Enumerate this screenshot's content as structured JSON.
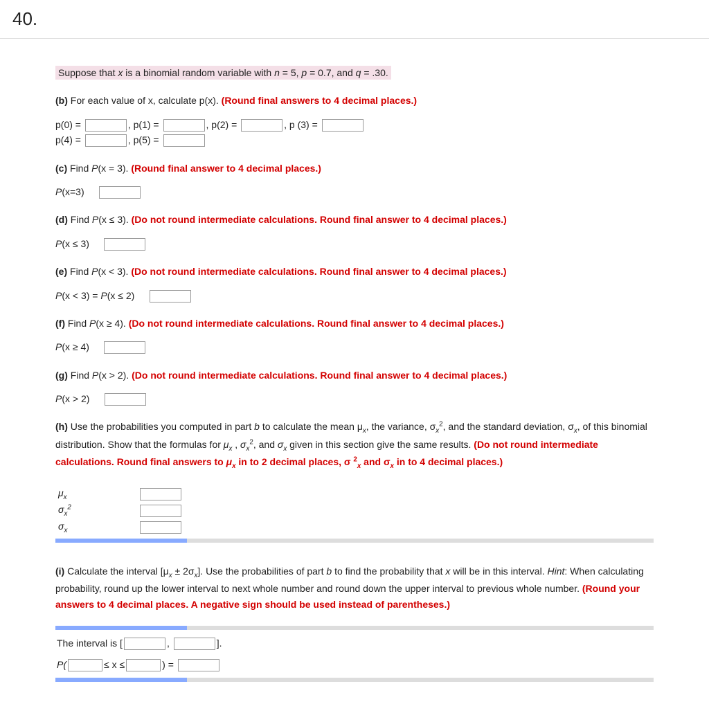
{
  "question_number": "40.",
  "intro_prefix": "Suppose that ",
  "intro_var": "x",
  "intro_mid": " is a binomial random variable with ",
  "intro_n": "n",
  "intro_eq1": " = 5, ",
  "intro_p": "p",
  "intro_eq2": " = 0.7, and ",
  "intro_q": "q",
  "intro_eq3": " = .30.",
  "partB": {
    "label": "(b)",
    "text": " For each value of x, calculate p(x). ",
    "round": "(Round final answers to 4 decimal places.)",
    "p0": "p(0) = ",
    "comma": ", ",
    "p1": "p(1) = ",
    "p2": "p(2) = ",
    "p3": "p (3) = ",
    "p4": "p(4) = ",
    "p5": "p(5) = "
  },
  "partC": {
    "label": "(c)",
    "text": " Find ",
    "pxa": "P",
    "pxb": "(x = 3). ",
    "round": "(Round final answer to 4 decimal places.)",
    "ans_label_a": "P",
    "ans_label_b": "(x=3)"
  },
  "partD": {
    "label": "(d)",
    "text": " Find ",
    "pxa": "P",
    "pxb": "(x ≤ 3). ",
    "round": "(Do not round intermediate calculations. Round final answer to 4 decimal places.)",
    "ans_label_a": "P",
    "ans_label_b": "(x ≤ 3)"
  },
  "partE": {
    "label": "(e)",
    "text": " Find ",
    "pxa": "P",
    "pxb": "(x < 3). ",
    "round": "(Do not round intermediate calculations. Round final answer to 4 decimal places.)",
    "ans_label_a": "P",
    "ans_label_b": "(x < 3) = ",
    "ans_label_c": "P",
    "ans_label_d": "(x ≤ 2)"
  },
  "partF": {
    "label": "(f)",
    "text": " Find ",
    "pxa": "P",
    "pxb": "(x ≥ 4). ",
    "round": "(Do not round intermediate calculations. Round final answer to 4 decimal places.)",
    "ans_label_a": "P",
    "ans_label_b": "(x ≥ 4)"
  },
  "partG": {
    "label": "(g)",
    "text": " Find ",
    "pxa": "P",
    "pxb": "(x > 2). ",
    "round": "(Do not round intermediate calculations. Round final answer to 4 decimal places.)",
    "ans_label_a": "P",
    "ans_label_b": "(x > 2)"
  },
  "partH": {
    "label": "(h)",
    "text1": " Use the probabilities you computed in part ",
    "text_b": "b",
    "text2": " to calculate the mean μ",
    "sub_x1": "x",
    "text3": ", the variance, σ",
    "supsub1": "2x",
    "text4": ", and the standard deviation, σ",
    "sub_x2": "x",
    "text5": ", of this binomial distribution. Show that the formulas for ",
    "mu": "μ",
    "sub_x3": "x",
    "comma1": " , ",
    "sig2": "σ",
    "supsub2": "2x",
    "comma2": ", and ",
    "sig": "σ",
    "sub_x4": "x",
    "text6": " given in this section give the same results. ",
    "round1": "(Do not round intermediate calculations. Round final answers to ",
    "mu_red": "μ",
    "sub_x5": "x",
    "round2": " in to 2 decimal places, σ ",
    "sup2": "2",
    "sub_x6": "x",
    "round3": " and σ",
    "sub_x7": "x",
    "round4": " in to 4 decimal places.)",
    "row1": "μx",
    "row2": "σ2x",
    "row3": "σx"
  },
  "partI": {
    "label": "(i)",
    "text1": " Calculate the interval [μ",
    "sub_x1": "x",
    "text2": " ± 2σ",
    "sub_x2": "x",
    "text3": "]. Use the probabilities of part ",
    "text_b": "b",
    "text4": " to find the probability that ",
    "text_x": "x",
    "text5": " will be in this interval. ",
    "hint": "Hint",
    "text6": ": When calculating probability, round up the lower interval to next whole number and round down the upper interval to previous whole number. ",
    "round": "(Round your answers to 4 decimal places. A negative sign should be used instead of parentheses.)",
    "intlabel": "The interval is [",
    "intcomma": ", ",
    "intend": "].",
    "pline_a": "P(",
    "pline_b": "≤ x ≤",
    "pline_c": ") = "
  }
}
